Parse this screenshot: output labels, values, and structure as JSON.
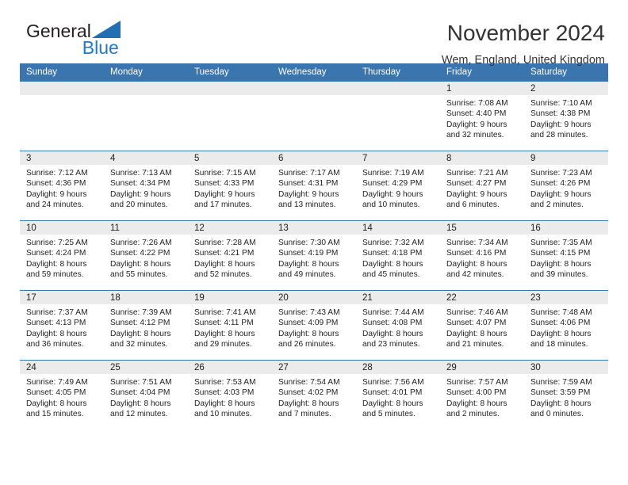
{
  "brand": {
    "name_part1": "General",
    "name_part2": "Blue",
    "triangle_icon": "blue-triangle-icon",
    "triangle_color": "#1f7ac4"
  },
  "header": {
    "title": "November 2024",
    "subtitle": "Wem, England, United Kingdom"
  },
  "colors": {
    "header_blue": "#3a75b0",
    "daynum_gray": "#ebebeb",
    "text": "#222222",
    "brand_blue": "#1f7ac4"
  },
  "weekdays": [
    "Sunday",
    "Monday",
    "Tuesday",
    "Wednesday",
    "Thursday",
    "Friday",
    "Saturday"
  ],
  "labels": {
    "sunrise": "Sunrise:",
    "sunset": "Sunset:",
    "daylight": "Daylight:"
  },
  "weeks": [
    [
      {
        "empty": true
      },
      {
        "empty": true
      },
      {
        "empty": true
      },
      {
        "empty": true
      },
      {
        "empty": true
      },
      {
        "day": "1",
        "sunrise": "Sunrise: 7:08 AM",
        "sunset": "Sunset: 4:40 PM",
        "daylight": "Daylight: 9 hours and 32 minutes."
      },
      {
        "day": "2",
        "sunrise": "Sunrise: 7:10 AM",
        "sunset": "Sunset: 4:38 PM",
        "daylight": "Daylight: 9 hours and 28 minutes."
      }
    ],
    [
      {
        "day": "3",
        "sunrise": "Sunrise: 7:12 AM",
        "sunset": "Sunset: 4:36 PM",
        "daylight": "Daylight: 9 hours and 24 minutes."
      },
      {
        "day": "4",
        "sunrise": "Sunrise: 7:13 AM",
        "sunset": "Sunset: 4:34 PM",
        "daylight": "Daylight: 9 hours and 20 minutes."
      },
      {
        "day": "5",
        "sunrise": "Sunrise: 7:15 AM",
        "sunset": "Sunset: 4:33 PM",
        "daylight": "Daylight: 9 hours and 17 minutes."
      },
      {
        "day": "6",
        "sunrise": "Sunrise: 7:17 AM",
        "sunset": "Sunset: 4:31 PM",
        "daylight": "Daylight: 9 hours and 13 minutes."
      },
      {
        "day": "7",
        "sunrise": "Sunrise: 7:19 AM",
        "sunset": "Sunset: 4:29 PM",
        "daylight": "Daylight: 9 hours and 10 minutes."
      },
      {
        "day": "8",
        "sunrise": "Sunrise: 7:21 AM",
        "sunset": "Sunset: 4:27 PM",
        "daylight": "Daylight: 9 hours and 6 minutes."
      },
      {
        "day": "9",
        "sunrise": "Sunrise: 7:23 AM",
        "sunset": "Sunset: 4:26 PM",
        "daylight": "Daylight: 9 hours and 2 minutes."
      }
    ],
    [
      {
        "day": "10",
        "sunrise": "Sunrise: 7:25 AM",
        "sunset": "Sunset: 4:24 PM",
        "daylight": "Daylight: 8 hours and 59 minutes."
      },
      {
        "day": "11",
        "sunrise": "Sunrise: 7:26 AM",
        "sunset": "Sunset: 4:22 PM",
        "daylight": "Daylight: 8 hours and 55 minutes."
      },
      {
        "day": "12",
        "sunrise": "Sunrise: 7:28 AM",
        "sunset": "Sunset: 4:21 PM",
        "daylight": "Daylight: 8 hours and 52 minutes."
      },
      {
        "day": "13",
        "sunrise": "Sunrise: 7:30 AM",
        "sunset": "Sunset: 4:19 PM",
        "daylight": "Daylight: 8 hours and 49 minutes."
      },
      {
        "day": "14",
        "sunrise": "Sunrise: 7:32 AM",
        "sunset": "Sunset: 4:18 PM",
        "daylight": "Daylight: 8 hours and 45 minutes."
      },
      {
        "day": "15",
        "sunrise": "Sunrise: 7:34 AM",
        "sunset": "Sunset: 4:16 PM",
        "daylight": "Daylight: 8 hours and 42 minutes."
      },
      {
        "day": "16",
        "sunrise": "Sunrise: 7:35 AM",
        "sunset": "Sunset: 4:15 PM",
        "daylight": "Daylight: 8 hours and 39 minutes."
      }
    ],
    [
      {
        "day": "17",
        "sunrise": "Sunrise: 7:37 AM",
        "sunset": "Sunset: 4:13 PM",
        "daylight": "Daylight: 8 hours and 36 minutes."
      },
      {
        "day": "18",
        "sunrise": "Sunrise: 7:39 AM",
        "sunset": "Sunset: 4:12 PM",
        "daylight": "Daylight: 8 hours and 32 minutes."
      },
      {
        "day": "19",
        "sunrise": "Sunrise: 7:41 AM",
        "sunset": "Sunset: 4:11 PM",
        "daylight": "Daylight: 8 hours and 29 minutes."
      },
      {
        "day": "20",
        "sunrise": "Sunrise: 7:43 AM",
        "sunset": "Sunset: 4:09 PM",
        "daylight": "Daylight: 8 hours and 26 minutes."
      },
      {
        "day": "21",
        "sunrise": "Sunrise: 7:44 AM",
        "sunset": "Sunset: 4:08 PM",
        "daylight": "Daylight: 8 hours and 23 minutes."
      },
      {
        "day": "22",
        "sunrise": "Sunrise: 7:46 AM",
        "sunset": "Sunset: 4:07 PM",
        "daylight": "Daylight: 8 hours and 21 minutes."
      },
      {
        "day": "23",
        "sunrise": "Sunrise: 7:48 AM",
        "sunset": "Sunset: 4:06 PM",
        "daylight": "Daylight: 8 hours and 18 minutes."
      }
    ],
    [
      {
        "day": "24",
        "sunrise": "Sunrise: 7:49 AM",
        "sunset": "Sunset: 4:05 PM",
        "daylight": "Daylight: 8 hours and 15 minutes."
      },
      {
        "day": "25",
        "sunrise": "Sunrise: 7:51 AM",
        "sunset": "Sunset: 4:04 PM",
        "daylight": "Daylight: 8 hours and 12 minutes."
      },
      {
        "day": "26",
        "sunrise": "Sunrise: 7:53 AM",
        "sunset": "Sunset: 4:03 PM",
        "daylight": "Daylight: 8 hours and 10 minutes."
      },
      {
        "day": "27",
        "sunrise": "Sunrise: 7:54 AM",
        "sunset": "Sunset: 4:02 PM",
        "daylight": "Daylight: 8 hours and 7 minutes."
      },
      {
        "day": "28",
        "sunrise": "Sunrise: 7:56 AM",
        "sunset": "Sunset: 4:01 PM",
        "daylight": "Daylight: 8 hours and 5 minutes."
      },
      {
        "day": "29",
        "sunrise": "Sunrise: 7:57 AM",
        "sunset": "Sunset: 4:00 PM",
        "daylight": "Daylight: 8 hours and 2 minutes."
      },
      {
        "day": "30",
        "sunrise": "Sunrise: 7:59 AM",
        "sunset": "Sunset: 3:59 PM",
        "daylight": "Daylight: 8 hours and 0 minutes."
      }
    ]
  ]
}
